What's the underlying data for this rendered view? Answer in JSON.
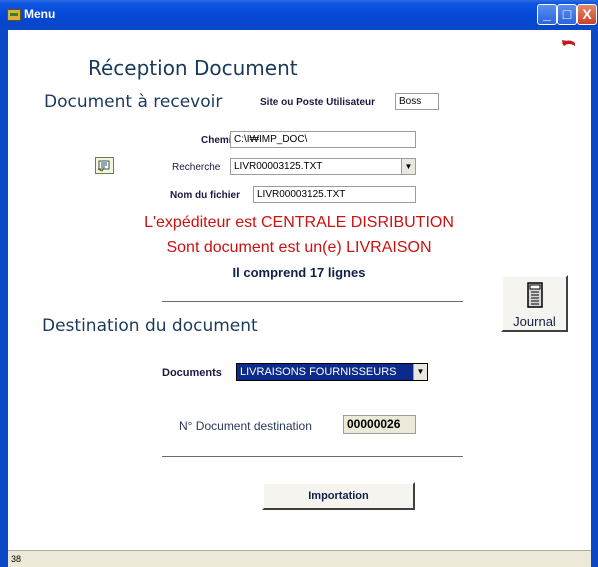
{
  "window": {
    "title": "Menu",
    "minimize": "_",
    "maximize": "□",
    "close": "X"
  },
  "headings": {
    "reception": "Réception Document",
    "document_to_receive": "Document à recevoir",
    "destination": "Destination du document"
  },
  "site": {
    "label": "Site ou Poste Utilisateur",
    "value": "Boss"
  },
  "chemin": {
    "label": "Chemin",
    "value": "C:\\I₩IMP_DOC\\"
  },
  "recherche": {
    "label": "Recherche",
    "value": "LIVR00003125.TXT"
  },
  "nom_fichier": {
    "label": "Nom du fichier",
    "value": "LIVR00003125.TXT"
  },
  "messages": {
    "expediteur": "L'expéditeur est CENTRALE DISRIBUTION",
    "type": "Sont document est un(e) LIVRAISON",
    "lignes": "Il comprend 17 lignes"
  },
  "journal_button": {
    "label": "Journal"
  },
  "documents": {
    "label": "Documents",
    "value": "LIVRAISONS FOURNISSEURS"
  },
  "destination_number": {
    "label": "N° Document destination",
    "value": "00000026"
  },
  "import_button": {
    "label": "Importation"
  },
  "status": {
    "text": "38"
  },
  "icons": {
    "app": "app-icon",
    "back": "back-arrow-icon",
    "folder": "folder-icon",
    "journal": "journal-icon"
  }
}
